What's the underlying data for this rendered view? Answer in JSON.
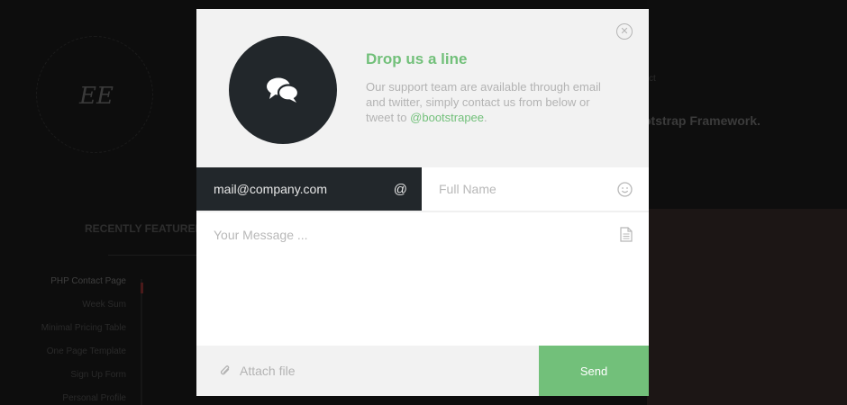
{
  "background": {
    "logo_text": "EE",
    "featured_title": "RECENTLY FEATURED",
    "menu_items": [
      "PHP Contact Page",
      "Week Sum",
      "Minimal Pricing Table",
      "One Page Template",
      "Sign Up Form",
      "Personal Profile"
    ],
    "right_small": "ct",
    "right_headline": "otstrap Framework."
  },
  "modal": {
    "close_icon": "close-circle-icon",
    "avatar_icon": "chat-bubbles-icon",
    "heading": "Drop us a line",
    "desc_text": "Our support team are available through email and twitter, simply contact us from below or tweet to",
    "desc_link": "@bootstrapee",
    "desc_end": ".",
    "email_value": "mail@company.com",
    "email_icon": "@",
    "name_placeholder": "Full Name",
    "name_icon": "smiley-icon",
    "message_placeholder": "Your Message ...",
    "message_icon": "document-icon",
    "attach_icon": "paperclip-icon",
    "attach_label": "Attach file",
    "send_label": "Send"
  },
  "colors": {
    "accent": "#72c07a",
    "dark": "#22272b",
    "panel": "#f2f2f2"
  }
}
